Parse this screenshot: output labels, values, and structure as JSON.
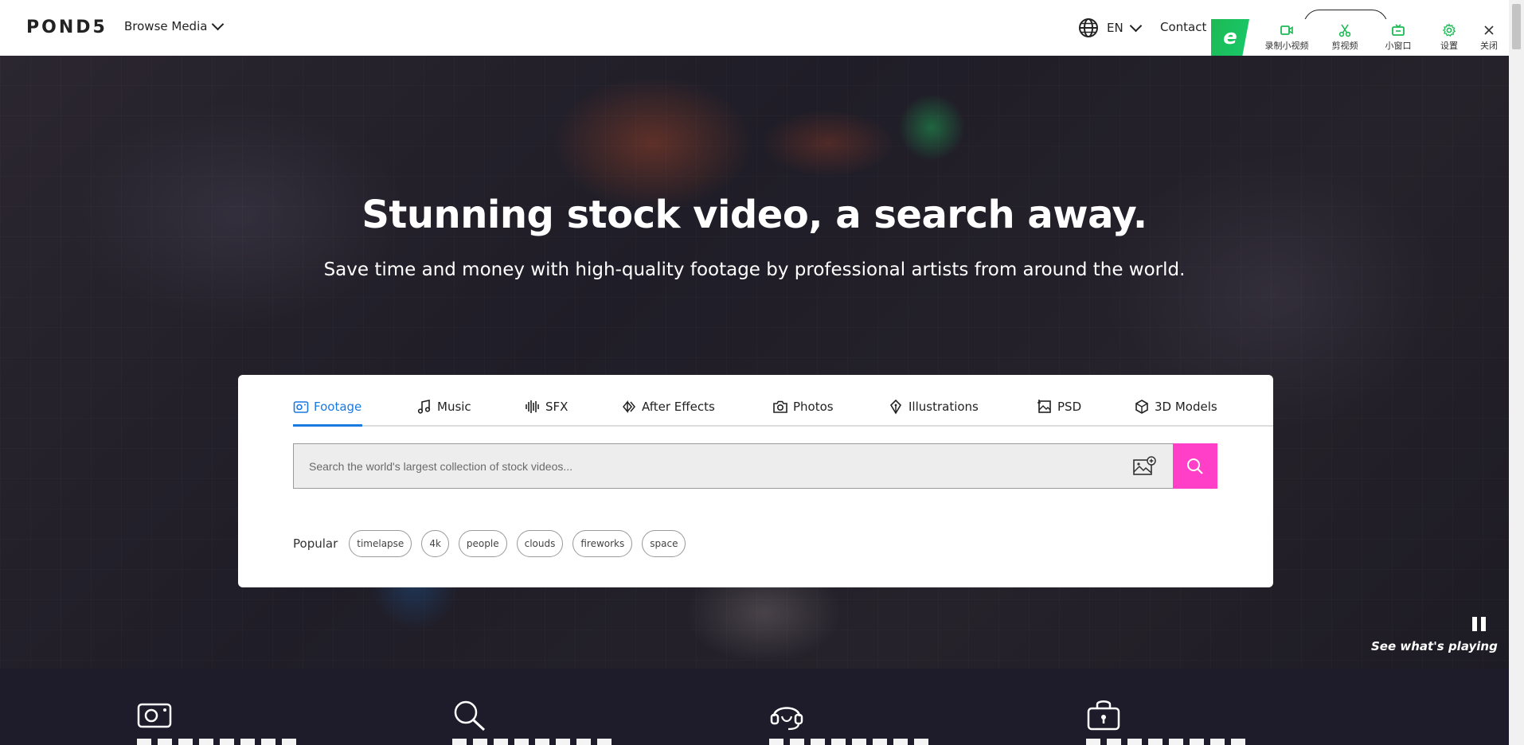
{
  "header": {
    "logo": "POND5",
    "browse_label": "Browse Media",
    "lang_label": "EN",
    "contact_label": "Contact"
  },
  "toolbar": {
    "logo_letter": "e",
    "items": [
      "录制小视频",
      "剪视频",
      "小窗口",
      "设置",
      "关闭"
    ]
  },
  "hero": {
    "title": "Stunning stock video, a search away.",
    "subtitle": "Save time and money with high-quality footage by professional artists from around the world."
  },
  "search": {
    "tabs": [
      "Footage",
      "Music",
      "SFX",
      "After Effects",
      "Photos",
      "Illustrations",
      "PSD",
      "3D Models"
    ],
    "active_tab": "Footage",
    "placeholder": "Search the world's largest collection of stock videos...",
    "popular_label": "Popular",
    "popular_tags": [
      "timelapse",
      "4k",
      "people",
      "clouds",
      "fireworks",
      "space"
    ]
  },
  "player": {
    "see_playing": "See what's playing"
  },
  "colors": {
    "accent_blue": "#1a7ae0",
    "search_pink": "#ff3fc8",
    "toolbar_green": "#1db954",
    "band_dark": "#1e1b2b"
  },
  "features": {
    "icons": [
      "video-camera-icon",
      "search-icon",
      "headset-support-icon",
      "lock-bag-icon"
    ]
  }
}
